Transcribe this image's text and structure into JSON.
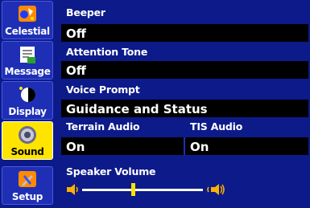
{
  "sidebar": {
    "tabs": [
      {
        "label": "Celestial",
        "icon": "celestial-icon",
        "active": false
      },
      {
        "label": "Message",
        "icon": "message-icon",
        "active": false
      },
      {
        "label": "Display",
        "icon": "display-icon",
        "active": false
      },
      {
        "label": "Sound",
        "icon": "speaker-icon",
        "active": true
      },
      {
        "label": "Setup",
        "icon": "setup-tools-icon",
        "active": false
      }
    ]
  },
  "settings": {
    "beeper": {
      "label": "Beeper",
      "value": "Off"
    },
    "attention_tone": {
      "label": "Attention Tone",
      "value": "Off"
    },
    "voice_prompt": {
      "label": "Voice Prompt",
      "value": "Guidance and Status"
    },
    "terrain_audio": {
      "label": "Terrain Audio",
      "value": "On"
    },
    "tis_audio": {
      "label": "TIS Audio",
      "value": "On"
    },
    "speaker_volume": {
      "label": "Speaker Volume",
      "level": 0.42
    }
  },
  "colors": {
    "background": "#0c1a8a",
    "tab": "#1e2fb5",
    "active_tab": "#ffe400",
    "field": "#000000",
    "slider_thumb": "#ffe400"
  }
}
